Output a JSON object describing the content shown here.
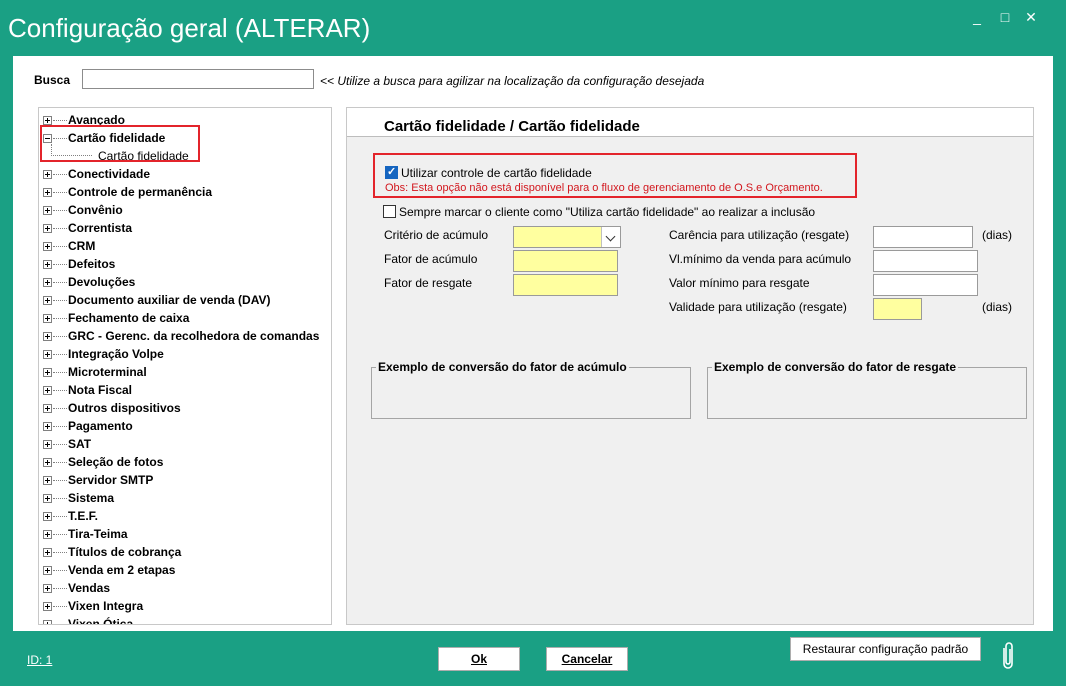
{
  "window": {
    "title": "Configuração geral (ALTERAR)",
    "controls": {
      "minimize": "_",
      "maximize": "□",
      "close": "✕"
    }
  },
  "search": {
    "label": "Busca",
    "value": "",
    "placeholder": "",
    "hint": "<< Utilize a busca para agilizar na localização da configuração desejada"
  },
  "tree": {
    "items": [
      {
        "label": "Avançado",
        "expanded": false
      },
      {
        "label": "Cartão fidelidade",
        "expanded": true,
        "child": "Cartão fidelidade"
      },
      {
        "label": "Conectividade",
        "expanded": false
      },
      {
        "label": "Controle de permanência",
        "expanded": false
      },
      {
        "label": "Convênio",
        "expanded": false
      },
      {
        "label": "Correntista",
        "expanded": false
      },
      {
        "label": "CRM",
        "expanded": false
      },
      {
        "label": "Defeitos",
        "expanded": false
      },
      {
        "label": "Devoluções",
        "expanded": false
      },
      {
        "label": "Documento auxiliar de venda (DAV)",
        "expanded": false
      },
      {
        "label": "Fechamento de caixa",
        "expanded": false
      },
      {
        "label": "GRC - Gerenc. da recolhedora de comandas",
        "expanded": false
      },
      {
        "label": "Integração Volpe",
        "expanded": false
      },
      {
        "label": "Microterminal",
        "expanded": false
      },
      {
        "label": "Nota Fiscal",
        "expanded": false
      },
      {
        "label": "Outros dispositivos",
        "expanded": false
      },
      {
        "label": "Pagamento",
        "expanded": false
      },
      {
        "label": "SAT",
        "expanded": false
      },
      {
        "label": "Seleção de fotos",
        "expanded": false
      },
      {
        "label": "Servidor SMTP",
        "expanded": false
      },
      {
        "label": "Sistema",
        "expanded": false
      },
      {
        "label": "T.E.F.",
        "expanded": false
      },
      {
        "label": "Tira-Teima",
        "expanded": false
      },
      {
        "label": "Títulos de cobrança",
        "expanded": false
      },
      {
        "label": "Venda em 2 etapas",
        "expanded": false
      },
      {
        "label": "Vendas",
        "expanded": false
      },
      {
        "label": "Vixen Integra",
        "expanded": false
      },
      {
        "label": "Vixen Ótica",
        "expanded": false
      }
    ]
  },
  "content": {
    "title": "Cartão fidelidade / Cartão fidelidade",
    "use_card_control": {
      "label": "Utilizar controle de cartão fidelidade",
      "checked": true
    },
    "obs": "Obs: Esta opção não está disponível para o fluxo de gerenciamento de O.S.e Orçamento.",
    "always_mark": {
      "label": "Sempre marcar o cliente como \"Utiliza cartão fidelidade\" ao realizar a inclusão",
      "checked": false
    },
    "left_fields": {
      "criterio": {
        "label": "Critério de acúmulo",
        "value": ""
      },
      "fator_acumulo": {
        "label": "Fator de acúmulo",
        "value": ""
      },
      "fator_resgate": {
        "label": "Fator de resgate",
        "value": ""
      }
    },
    "right_fields": {
      "carencia": {
        "label": "Carência para utilização (resgate)",
        "value": "",
        "unit": "(dias)"
      },
      "vl_minimo_venda": {
        "label": "Vl.mínimo da venda para acúmulo",
        "value": ""
      },
      "valor_minimo_resgate": {
        "label": "Valor mínimo para resgate",
        "value": ""
      },
      "validade": {
        "label": "Validade para utilização (resgate)",
        "value": "",
        "unit": "(dias)"
      }
    },
    "groups": {
      "acumulo": "Exemplo de conversão do fator de acúmulo",
      "resgate": "Exemplo de conversão do fator de resgate"
    }
  },
  "footer": {
    "id_link": "ID: 1",
    "ok": "Ok",
    "cancel": "Cancelar",
    "restore": "Restaurar configuração padrão",
    "attach_icon": "paperclip-icon"
  },
  "colors": {
    "frame": "#1aa084",
    "highlight_red": "#e3242b",
    "required_yellow": "#ffff9f",
    "obs_red": "#d2171e"
  }
}
